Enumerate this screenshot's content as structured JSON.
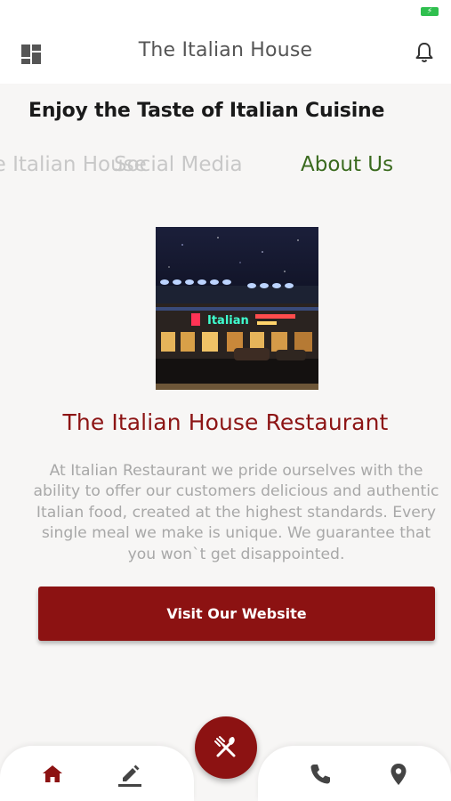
{
  "status_bar": {
    "battery_icon": "battery-charging-icon",
    "battery_color": "#2fbf4e"
  },
  "app_bar": {
    "title": "The Italian House",
    "left_icon": "dashboard-icon",
    "right_icon": "bell-icon"
  },
  "headline": "Enjoy the Taste of Italian Cuisine",
  "tabs": [
    {
      "label": "The Italian House",
      "visible_text": "use",
      "active": false
    },
    {
      "label": "Social Media",
      "active": false
    },
    {
      "label": "About Us",
      "active": true
    }
  ],
  "about": {
    "image_alt": "Italian House restaurant at night with neon sign",
    "sign_text": "Italian",
    "title": "The Italian House Restaurant",
    "description": "At Italian Restaurant we pride ourselves with the ability to offer our customers delicious and authentic Italian food, created at the highest standards. Every single meal we make is unique. We guarantee that you won`t get disappointed.",
    "button_label": "Visit Our Website"
  },
  "bottom_nav": {
    "items": [
      {
        "icon": "home-icon",
        "active": true
      },
      {
        "icon": "edit-icon",
        "active": false
      },
      {
        "icon": "phone-icon",
        "active": false
      },
      {
        "icon": "location-pin-icon",
        "active": false
      }
    ],
    "fab_icon": "fork-knife-icon"
  },
  "colors": {
    "accent": "#8c1212",
    "active_tab": "#3a6a1e",
    "inactive_tab": "#c8c8c8",
    "body_text": "#a8a8a8",
    "background": "#f7f6f5"
  }
}
